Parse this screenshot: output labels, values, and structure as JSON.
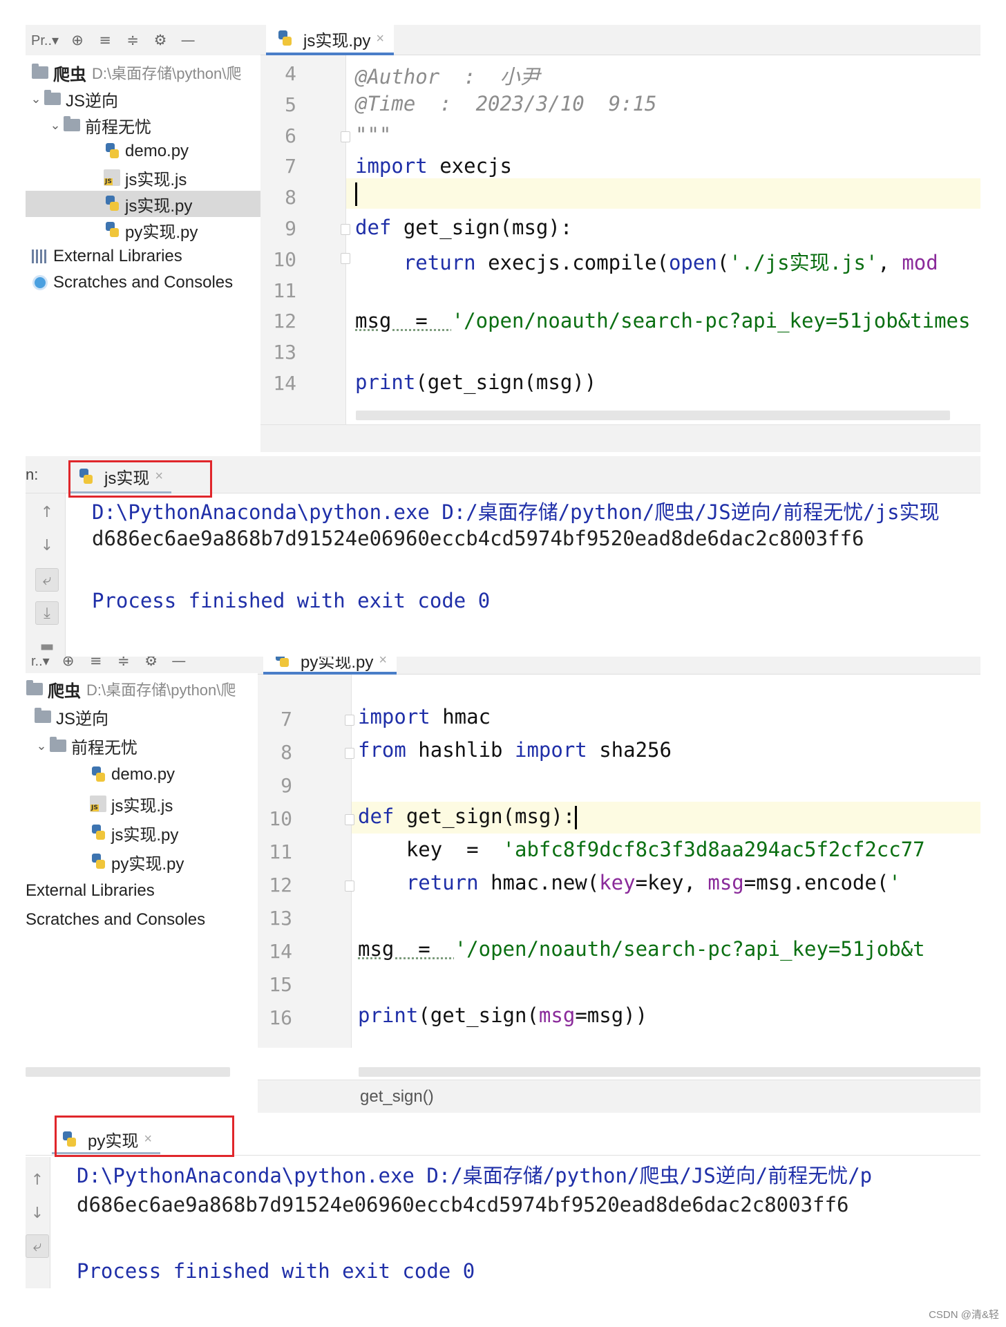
{
  "top": {
    "toolbar": {
      "project_label": "Pr..▾"
    },
    "tab": {
      "label": "js实现.py",
      "close": "×"
    },
    "tree": {
      "root_name": "爬虫",
      "root_path": "D:\\桌面存储\\python\\爬",
      "folder1": "JS逆向",
      "folder2": "前程无忧",
      "files": [
        "demo.py",
        "js实现.js",
        "js实现.py",
        "py实现.py"
      ],
      "external_libraries": "External Libraries",
      "scratches": "Scratches and Consoles"
    },
    "line_numbers": [
      "4",
      "5",
      "6",
      "7",
      "8",
      "9",
      "10",
      "11",
      "12",
      "13",
      "14"
    ],
    "code": {
      "author": "@Author  :  小尹",
      "time": "@Time  :  2023/3/10  9:15",
      "docstring_end": "\"\"\"",
      "import_kw": "import",
      "import_mod": " execjs",
      "def_kw": "def",
      "def_rest": " get_sign(msg):",
      "return_kw": "return",
      "return_mid": " execjs.compile(",
      "open_fn": "open",
      "open_paren": "(",
      "return_str": "'./js实现.js'",
      "return_tail": ", ",
      "return_mod": "mod",
      "msg_var": "msg  =  ",
      "msg_str": "'/open/noauth/search-pc?api_key=51job&times",
      "print_fn": "print",
      "print_rest": "(get_sign(msg))"
    },
    "run": {
      "run_label": "n:",
      "tab_label": "js实现",
      "close": "×",
      "command": "D:\\PythonAnaconda\\python.exe D:/桌面存储/python/爬虫/JS逆向/前程无忧/js实现",
      "result": "d686ec6ae9a868b7d91524e06960eccb4cd5974bf9520ead8de6dac2c8003ff6",
      "finished": "Process finished with exit code 0"
    }
  },
  "bottom": {
    "toolbar": {
      "project_label": "r..▾"
    },
    "tab": {
      "label": "py实现.py",
      "close": "×"
    },
    "tree": {
      "root_name": "爬虫",
      "root_path": "D:\\桌面存储\\python\\爬",
      "folder1": "JS逆向",
      "folder2": "前程无忧",
      "files": [
        "demo.py",
        "js实现.js",
        "js实现.py",
        "py实现.py"
      ],
      "external_libraries": "External Libraries",
      "scratches": "Scratches and Consoles"
    },
    "line_numbers": [
      "7",
      "8",
      "9",
      "10",
      "11",
      "12",
      "13",
      "14",
      "15",
      "16"
    ],
    "code": {
      "import_kw": "import",
      "import_mod": " hmac",
      "from_kw": "from",
      "from_mod": " hashlib ",
      "from_import": "import",
      "from_name": " sha256",
      "def_kw": "def",
      "def_rest": " get_sign(msg):",
      "key_var": "key  =  ",
      "key_str": "'abfc8f9dcf8c3f3d8aa294ac5f2cf2cc77",
      "return_kw": "return",
      "return_mid": " hmac.new(",
      "kw_key": "key",
      "kw_key_val": "=key, ",
      "kw_msg": "msg",
      "kw_msg_val": "=msg.encode(",
      "quote": "'",
      "msg_var": "msg  =  ",
      "msg_str": "'/open/noauth/search-pc?api_key=51job&t",
      "print_fn": "print",
      "print_mid": "(get_sign(",
      "print_kw": "msg",
      "print_tail": "=msg))"
    },
    "status_function": "get_sign()",
    "run": {
      "tab_label": "py实现",
      "close": "×",
      "command": "D:\\PythonAnaconda\\python.exe D:/桌面存储/python/爬虫/JS逆向/前程无忧/p",
      "result": "d686ec6ae9a868b7d91524e06960eccb4cd5974bf9520ead8de6dac2c8003ff6",
      "finished": "Process finished with exit code 0"
    }
  },
  "watermark": "CSDN @清&轻",
  "colors": {
    "keyword": "#1f2fa8",
    "string": "#0b6f12",
    "comment": "#8c8c8c",
    "parameter": "#8a2a9a",
    "highlight_box": "#e0262b",
    "current_line": "#fdfbe2"
  }
}
